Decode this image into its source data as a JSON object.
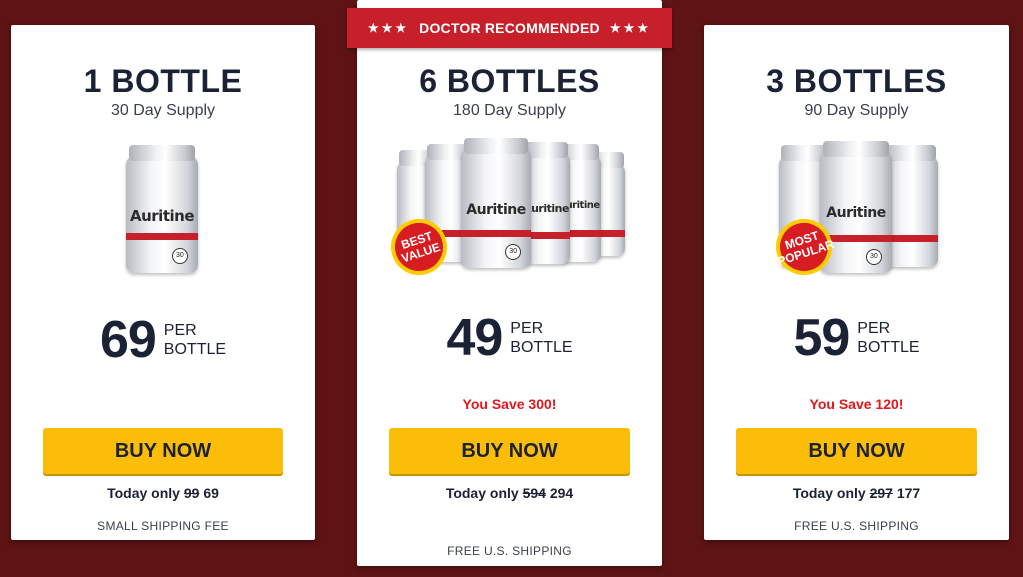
{
  "banner": {
    "label": "DOCTOR RECOMMENDED",
    "left_stars": "★★★",
    "right_stars": "★★★",
    "color": "#c8202a"
  },
  "brand": "Auritine",
  "packages": [
    {
      "title": "1 BOTTLE",
      "supply": "30 Day Supply",
      "bottle_count": 1,
      "badge": "",
      "price": "69",
      "per_line1": "PER",
      "per_line2": "BOTTLE",
      "savings": "",
      "button_label": "BUY NOW",
      "today_label": "Today only",
      "old_price": "99",
      "new_price": "69",
      "shipping": "SMALL SHIPPING FEE"
    },
    {
      "title": "6 BOTTLES",
      "supply": "180 Day Supply",
      "bottle_count": 6,
      "badge": "BEST VALUE",
      "price": "49",
      "per_line1": "PER",
      "per_line2": "BOTTLE",
      "savings": "You Save 300!",
      "button_label": "BUY NOW",
      "today_label": "Today only",
      "old_price": "594",
      "new_price": "294",
      "shipping": "FREE U.S. SHIPPING"
    },
    {
      "title": "3 BOTTLES",
      "supply": "90 Day Supply",
      "bottle_count": 3,
      "badge": "MOST POPULAR",
      "price": "59",
      "per_line1": "PER",
      "per_line2": "BOTTLE",
      "savings": "You Save 120!",
      "button_label": "BUY NOW",
      "today_label": "Today only",
      "old_price": "297",
      "new_price": "177",
      "shipping": "FREE U.S. SHIPPING"
    }
  ],
  "colors": {
    "background": "#5e1314",
    "button": "#fbbd08",
    "accent_red": "#c8202a",
    "savings_red": "#e0171b",
    "text_dark": "#1c2235"
  }
}
